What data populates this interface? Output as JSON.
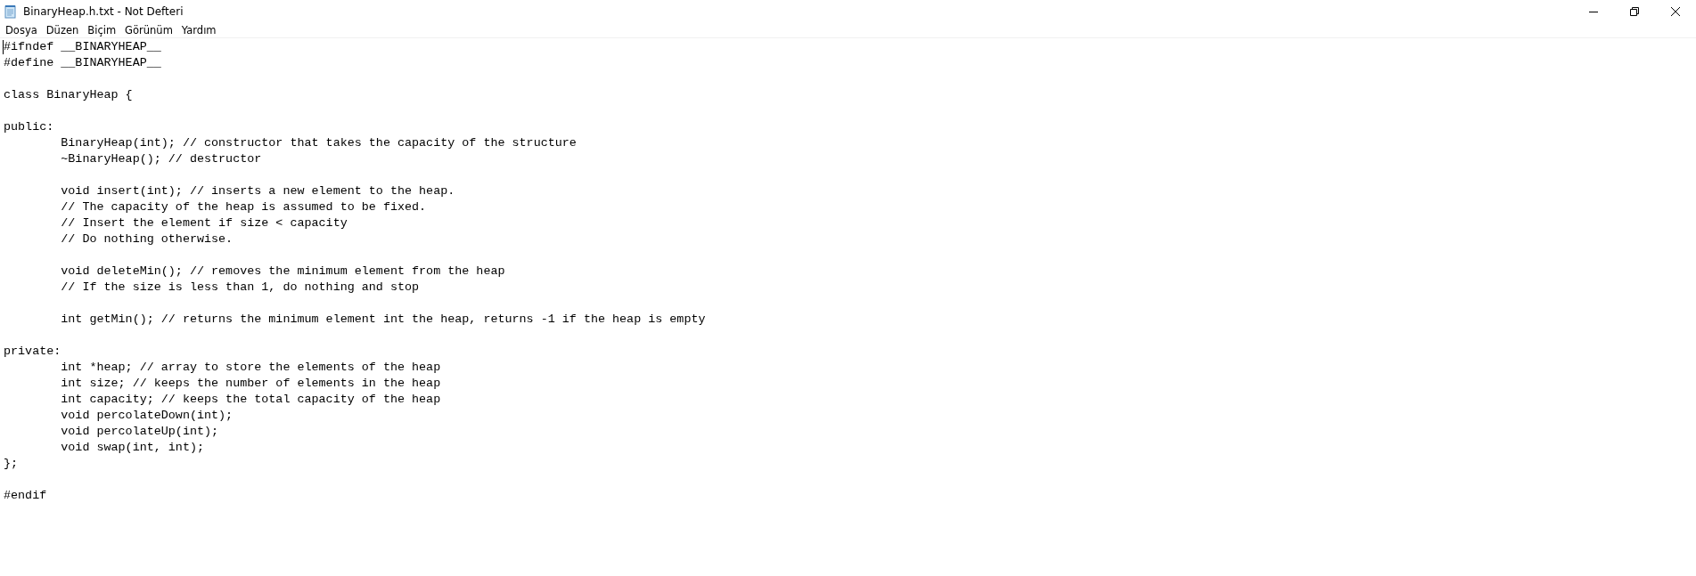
{
  "window": {
    "title": "BinaryHeap.h.txt - Not Defteri"
  },
  "menu": [
    "Dosya",
    "Düzen",
    "Biçim",
    "Görünüm",
    "Yardım"
  ],
  "editor": {
    "blocks": [
      [
        "#ifndef __BINARYHEAP__",
        "#define __BINARYHEAP__"
      ],
      [
        "class BinaryHeap {"
      ],
      [
        "public:",
        "\tBinaryHeap(int); // constructor that takes the capacity of the structure",
        "\t~BinaryHeap(); // destructor"
      ],
      [
        "\tvoid insert(int); // inserts a new element to the heap.",
        "\t// The capacity of the heap is assumed to be fixed.",
        "\t// Insert the element if size < capacity",
        "\t// Do nothing otherwise."
      ],
      [
        "\tvoid deleteMin(); // removes the minimum element from the heap",
        "\t// If the size is less than 1, do nothing and stop"
      ],
      [
        "\tint getMin(); // returns the minimum element int the heap, returns -1 if the heap is empty"
      ],
      [
        "private:",
        "\tint *heap; // array to store the elements of the heap",
        "\tint size; // keeps the number of elements in the heap",
        "\tint capacity; // keeps the total capacity of the heap",
        "\tvoid percolateDown(int);",
        "\tvoid percolateUp(int);",
        "\tvoid swap(int, int);",
        "};"
      ],
      [
        "#endif"
      ]
    ]
  }
}
